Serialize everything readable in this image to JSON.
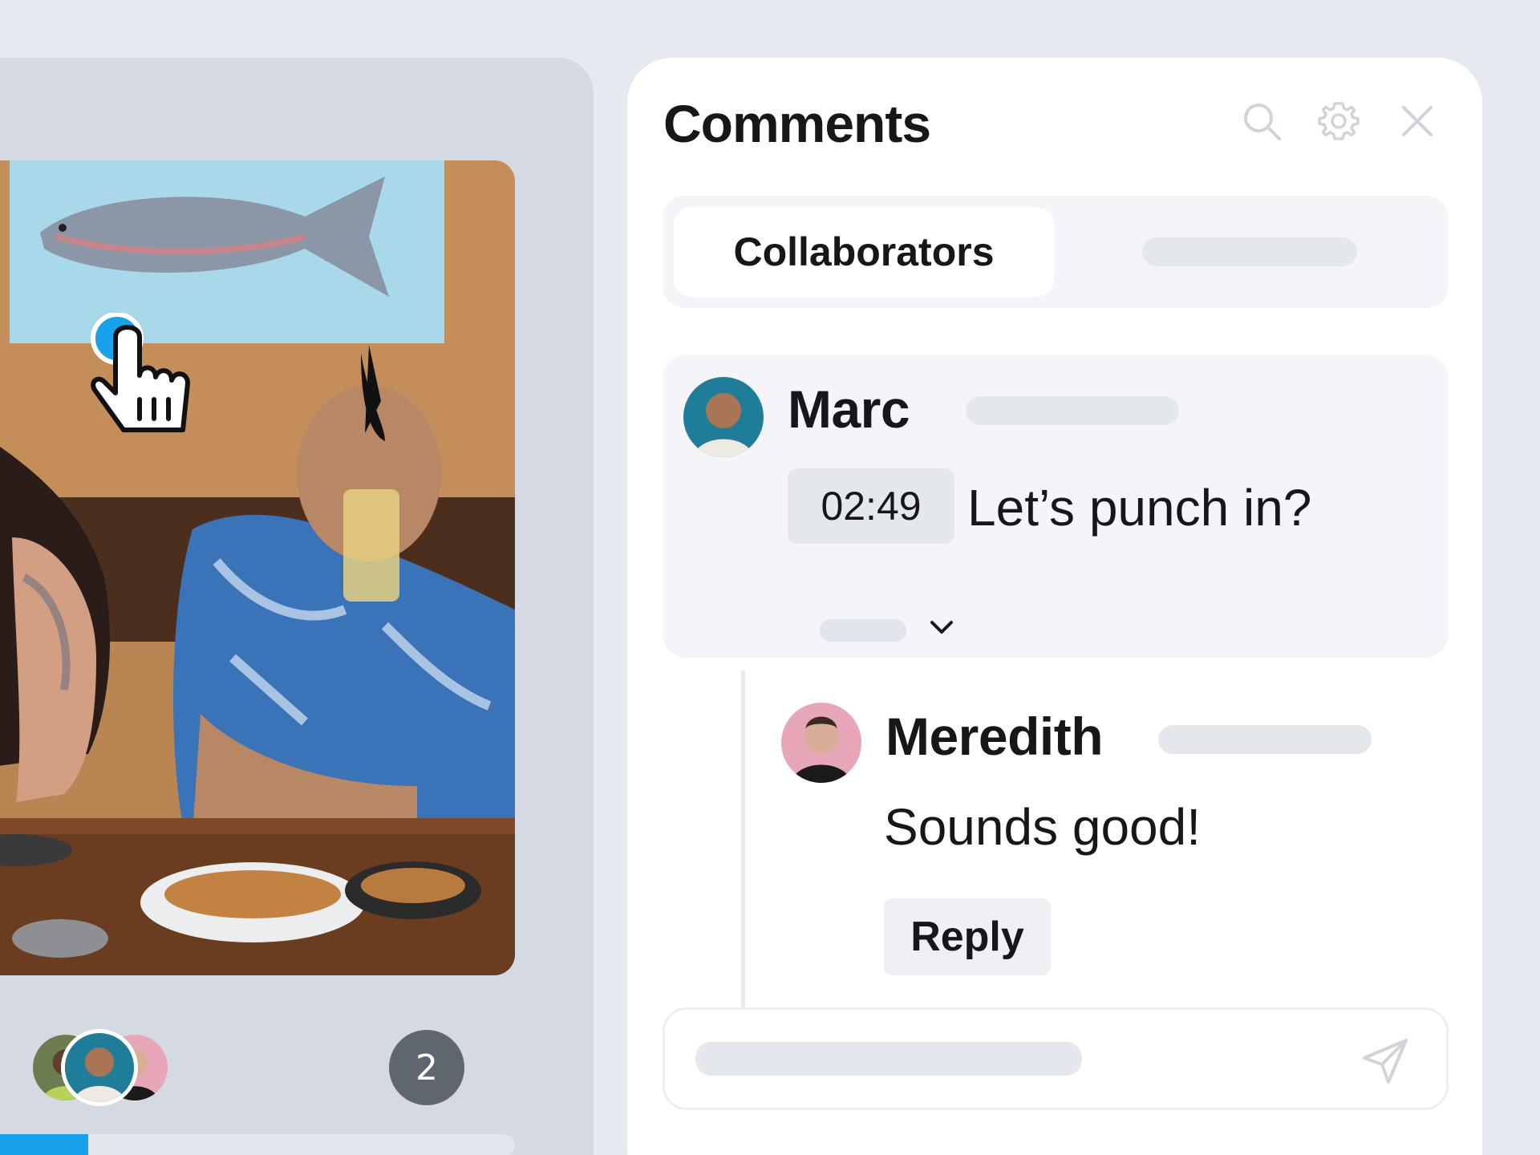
{
  "comments_panel": {
    "title": "Comments",
    "icons": {
      "search": "search-icon",
      "settings": "gear-icon",
      "close": "close-icon"
    },
    "tabs": {
      "active_label": "Collaborators"
    },
    "comment": {
      "author": "Marc",
      "timestamp": "02:49",
      "text": "Let’s punch in?"
    },
    "reply": {
      "author": "Meredith",
      "text": "Sounds good!",
      "reply_button_label": "Reply"
    },
    "composer": {
      "send_icon": "send-icon"
    }
  },
  "video_panel": {
    "viewer_count": "2",
    "progress_fraction": 0.22,
    "accent_color": "#18a2eb"
  }
}
